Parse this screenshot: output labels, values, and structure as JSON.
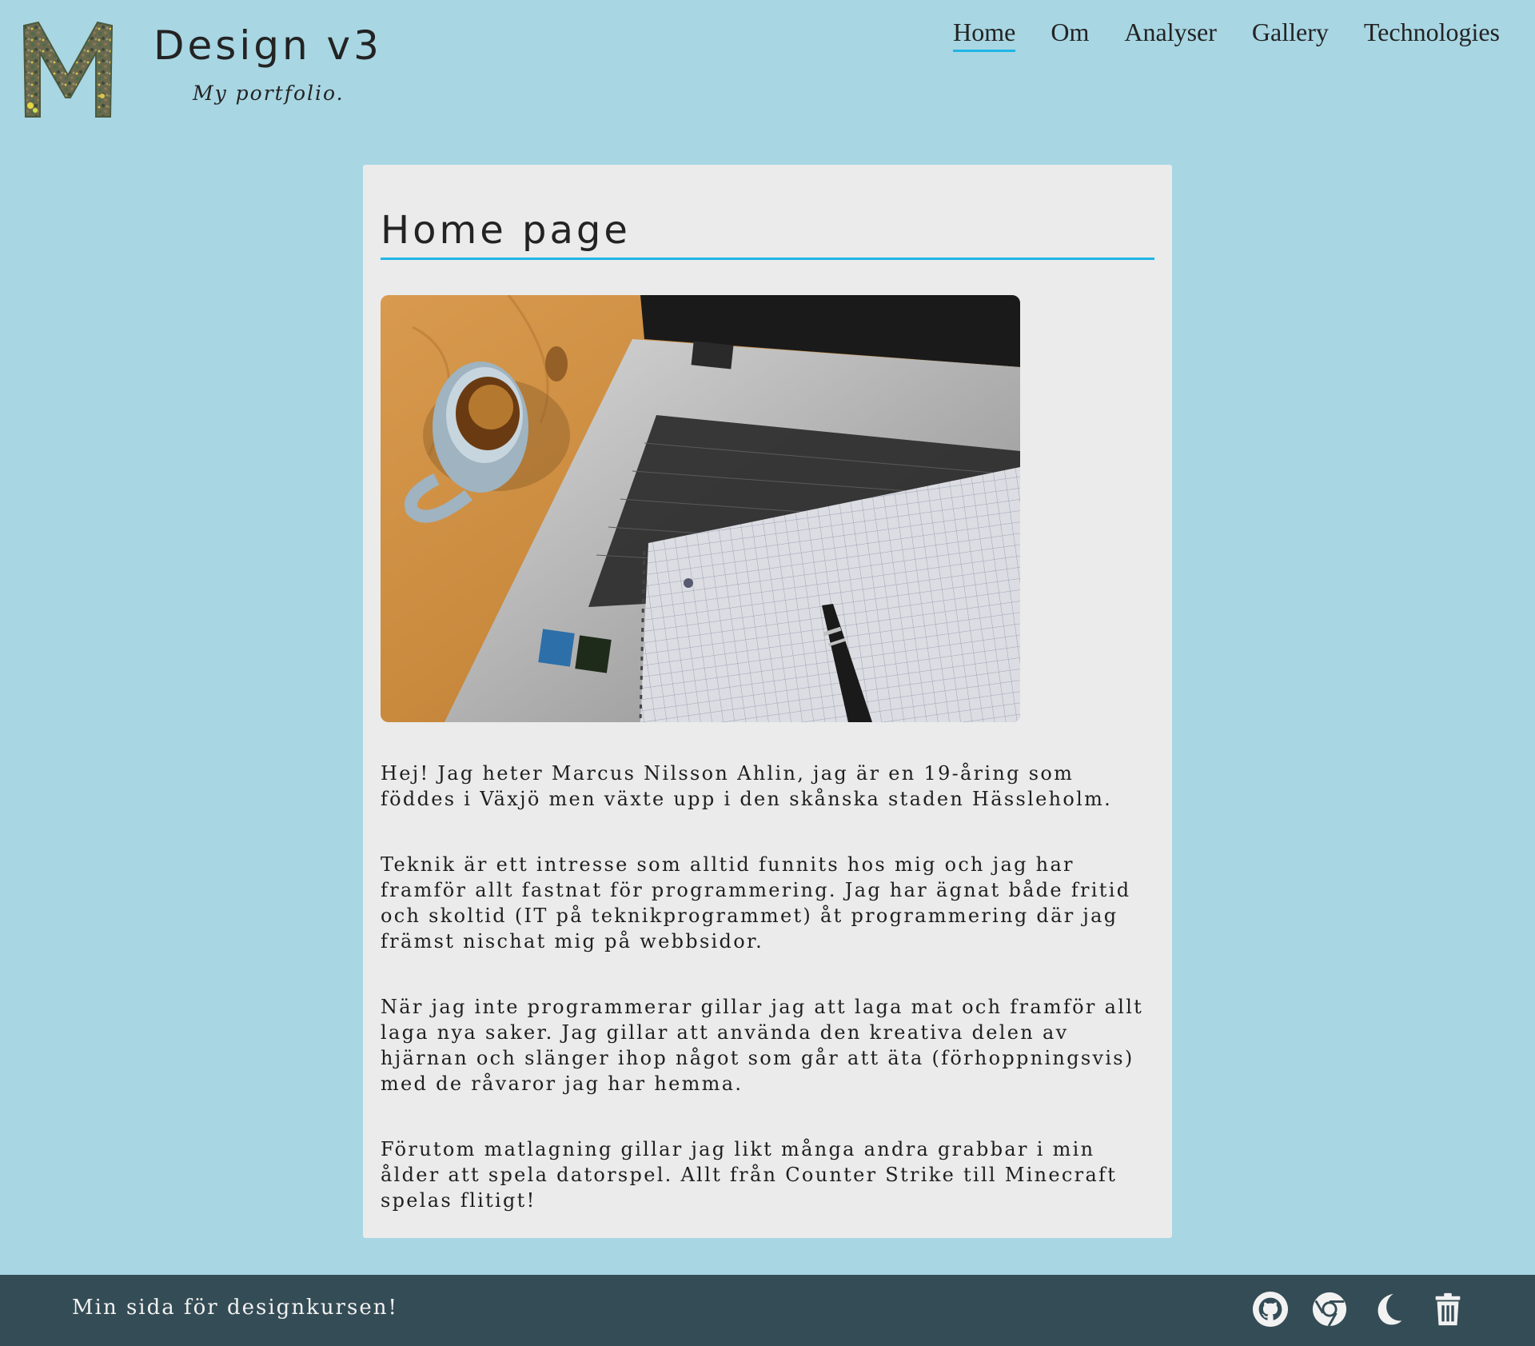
{
  "site": {
    "title": "Design v3",
    "tagline": "My portfolio.",
    "logo_letter": "M"
  },
  "nav": {
    "items": [
      {
        "label": "Home",
        "active": true
      },
      {
        "label": "Om",
        "active": false
      },
      {
        "label": "Analyser",
        "active": false
      },
      {
        "label": "Gallery",
        "active": false
      },
      {
        "label": "Technologies",
        "active": false
      }
    ]
  },
  "main": {
    "title": "Home page",
    "paragraphs": [
      "Hej! Jag heter Marcus Nilsson Ahlin, jag är en 19-åring som föddes i Växjö men växte upp i den skånska staden Hässleholm.",
      "Teknik är ett intresse som alltid funnits hos mig och jag har framför allt fastnat för programmering. Jag har ägnat både fritid och skoltid (IT på teknikprogrammet) åt programmering där jag främst nischat mig på webbsidor.",
      "När jag inte programmerar gillar jag att laga mat och framför allt laga nya saker. Jag gillar att använda den kreativa delen av hjärnan och slänger ihop något som går att äta (förhoppningsvis) med de råvaror jag har hemma.",
      "Förutom matlagning gillar jag likt många andra grabbar i min ålder att spela datorspel. Allt från Counter Strike till Minecraft spelas flitigt!"
    ]
  },
  "footer": {
    "text": "Min sida för designkursen!",
    "icons": [
      "github-icon",
      "chrome-icon",
      "moon-icon",
      "trash-icon"
    ]
  },
  "colors": {
    "background": "#a8d6e3",
    "card": "#ebebeb",
    "accent": "#1fb6e6",
    "footer": "#344c55"
  }
}
